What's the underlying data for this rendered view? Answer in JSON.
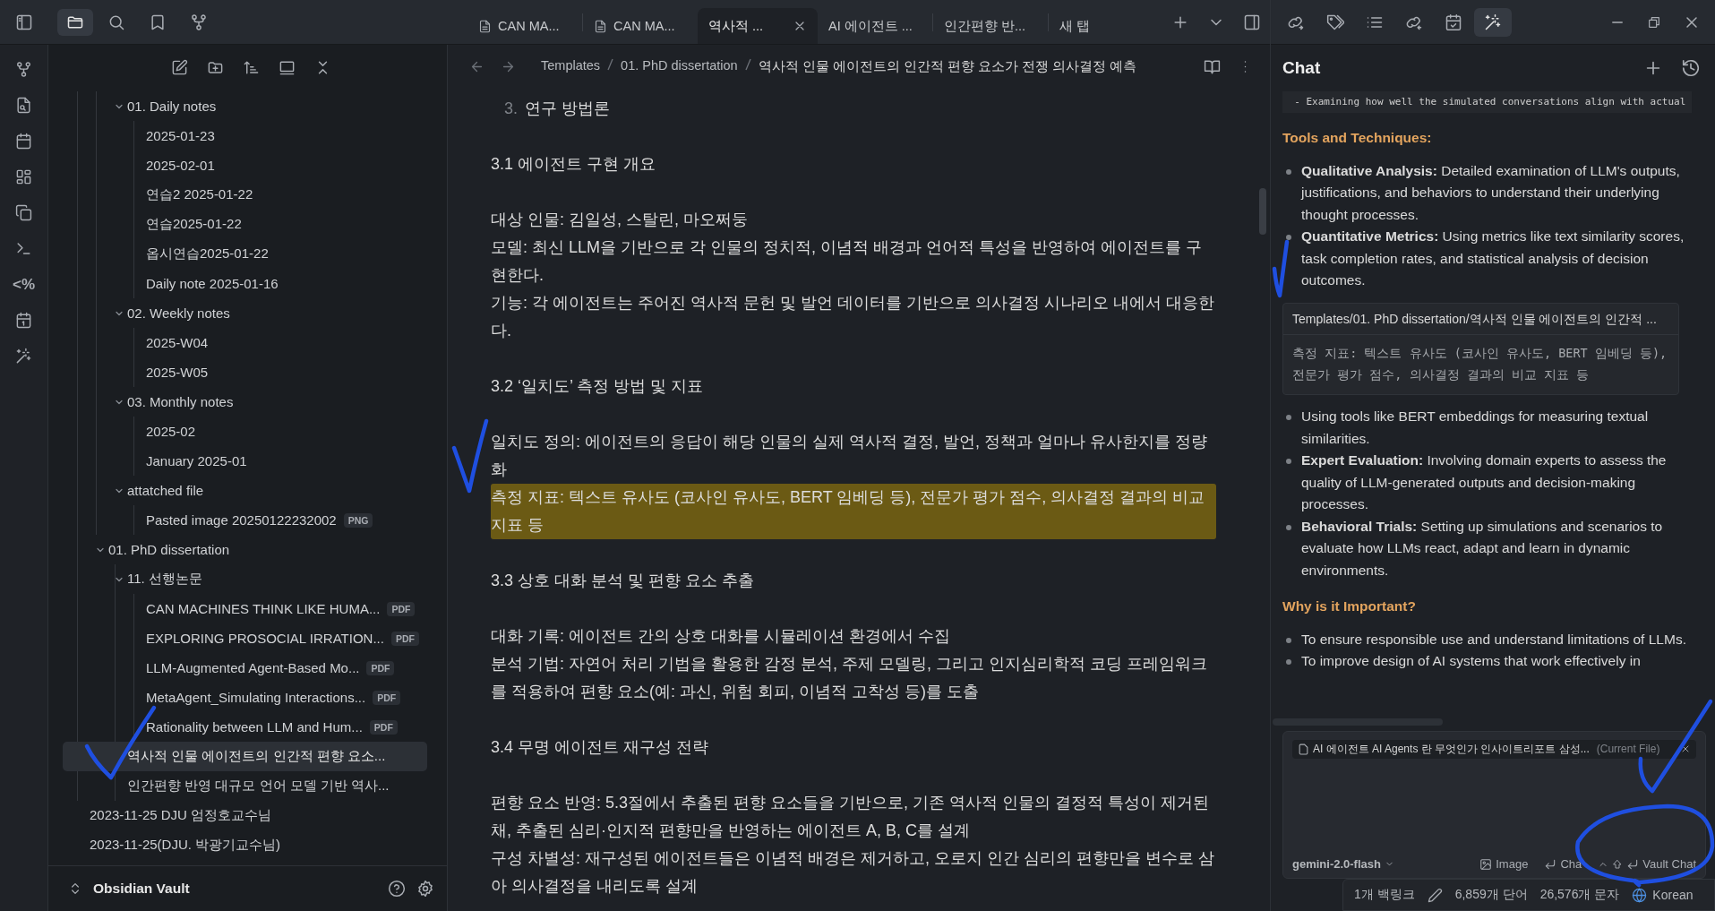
{
  "sidebar_tabs": [
    {
      "kind": "folder",
      "selected": true
    },
    {
      "kind": "search",
      "selected": false
    },
    {
      "kind": "bookmark",
      "selected": false
    },
    {
      "kind": "graph",
      "selected": false
    }
  ],
  "ribbon": [
    {
      "kind": "graph"
    },
    {
      "kind": "file-search"
    },
    {
      "kind": "calendar"
    },
    {
      "kind": "grid"
    },
    {
      "kind": "copy"
    },
    {
      "kind": "terminal"
    },
    {
      "kind": "glyph",
      "text": "<%"
    },
    {
      "kind": "calendar-day"
    },
    {
      "kind": "wand"
    }
  ],
  "file_tree": [
    {
      "children": [
        {
          "children": [
            {
              "label": "01. Daily notes",
              "expanded": true,
              "children": [
                {
                  "label": "2025-01-23",
                  "selected": false
                },
                {
                  "label": "2025-02-01",
                  "selected": false
                },
                {
                  "label": "연습2 2025-01-22",
                  "selected": false
                },
                {
                  "label": "연습2025-01-22",
                  "selected": false
                },
                {
                  "label": "옵시연습2025-01-22",
                  "selected": false
                },
                {
                  "label": "Daily note 2025-01-16",
                  "selected": false
                }
              ]
            },
            {
              "label": "02. Weekly notes",
              "expanded": true,
              "children": [
                {
                  "label": "2025-W04",
                  "selected": false
                },
                {
                  "label": "2025-W05",
                  "selected": false
                }
              ]
            },
            {
              "label": "03. Monthly notes",
              "expanded": true,
              "children": [
                {
                  "label": "2025-02",
                  "selected": false
                },
                {
                  "label": "January 2025-01",
                  "selected": false
                }
              ]
            },
            {
              "label": "attatched file",
              "expanded": true,
              "children": [
                {
                  "label": "Pasted image 20250122232002",
                  "badge": "PNG",
                  "selected": false
                }
              ]
            }
          ]
        },
        {
          "label": "01. PhD dissertation",
          "expanded": true,
          "children": [
            {
              "label": "11. 선행논문",
              "expanded": true,
              "children": [
                {
                  "label": "CAN MACHINES THINK LIKE HUMA...",
                  "badge": "PDF",
                  "selected": false
                },
                {
                  "label": "EXPLORING PROSOCIAL IRRATION...",
                  "badge": "PDF",
                  "selected": false
                },
                {
                  "label": "LLM-Augmented Agent-Based Mo...",
                  "badge": "PDF",
                  "selected": false
                },
                {
                  "label": "MetaAgent_Simulating Interactions...",
                  "badge": "PDF",
                  "selected": false
                },
                {
                  "label": "Rationality between LLM and Hum...",
                  "badge": "PDF",
                  "selected": false
                }
              ]
            },
            {
              "label": "역사적 인물 에이전트의 인간적 편향 요소...",
              "selected": true
            },
            {
              "label": "인간편향 반영 대규모 언어 모델 기반 역사...",
              "selected": false
            }
          ]
        }
      ]
    },
    {
      "label": "2023-11-25 DJU 엄정호교수님",
      "selected": false
    },
    {
      "label": "2023-11-25(DJU. 박광기교수님)",
      "selected": false
    }
  ],
  "vault": {
    "name": "Obsidian Vault"
  },
  "tabs": [
    {
      "label": "CAN MA...",
      "has_icon": true,
      "selected": false
    },
    {
      "label": "CAN MA...",
      "has_icon": true,
      "selected": false
    },
    {
      "label": "역사적 ...",
      "has_icon": false,
      "selected": true
    },
    {
      "label": "AI 에이전트 ...",
      "has_icon": false,
      "selected": false
    },
    {
      "label": "인간편향 반...",
      "has_icon": false,
      "selected": false
    },
    {
      "label": "새 탭",
      "has_icon": false,
      "selected": false
    }
  ],
  "breadcrumb": [
    "Templates",
    "01. PhD dissertation",
    "역사적 인물 에이전트의 인간적 편향 요소가 전쟁 의사결정 예측"
  ],
  "document": {
    "list_marker": "3.",
    "list_item": "연구 방법론",
    "blocks": [
      {
        "kind": "heading",
        "text": "3.1 에이전트 구현 개요"
      },
      {
        "kind": "paragraph",
        "lines": [
          {
            "text": "대상 인물: 김일성, 스탈린, 마오쩌둥",
            "highlighted": false
          },
          {
            "text": "모델: 최신 LLM을 기반으로 각 인물의 정치적, 이념적 배경과 언어적 특성을 반영하여 에이전트를 구현한다.",
            "highlighted": false
          },
          {
            "text": "기능: 각 에이전트는 주어진 역사적 문헌 및 발언 데이터를 기반으로 의사결정 시나리오 내에서 대응한다.",
            "highlighted": false
          }
        ]
      },
      {
        "kind": "heading",
        "text": "3.2 ‘일치도’ 측정 방법 및 지표"
      },
      {
        "kind": "paragraph",
        "lines": [
          {
            "text": "일치도 정의: 에이전트의 응답이 해당 인물의 실제 역사적 결정, 발언, 정책과 얼마나 유사한지를 정량화",
            "highlighted": false
          },
          {
            "text": "측정 지표: 텍스트 유사도 (코사인 유사도, BERT 임베딩 등), 전문가 평가 점수, 의사결정 결과의 비교 지표 등",
            "highlighted": true
          }
        ]
      },
      {
        "kind": "heading",
        "text": "3.3 상호 대화 분석 및 편향 요소 추출"
      },
      {
        "kind": "paragraph",
        "lines": [
          {
            "text": "대화 기록: 에이전트 간의 상호 대화를 시뮬레이션 환경에서 수집",
            "highlighted": false
          },
          {
            "text": "분석 기법: 자연어 처리 기법을 활용한 감정 분석, 주제 모델링, 그리고 인지심리학적 코딩 프레임워크를 적용하여 편향 요소(예: 과신, 위험 회피, 이념적 고착성 등)를 도출",
            "highlighted": false
          }
        ]
      },
      {
        "kind": "heading",
        "text": "3.4 무명 에이전트 재구성 전략"
      },
      {
        "kind": "paragraph",
        "lines": [
          {
            "text": "편향 요소 반영: 5.3절에서 추출된 편향 요소들을 기반으로, 기존 역사적 인물의 결정적 특성이 제거된 채, 추출된 심리·인지적 편향만을 반영하는 에이전트 A, B, C를 설계",
            "highlighted": false
          },
          {
            "text": "구성 차별성: 재구성된 에이전트들은 이념적 배경은 제거하고, 오로지 인간 심리의 편향만을 변수로 삼아 의사결정을 내리도록 설계",
            "highlighted": false
          }
        ]
      }
    ]
  },
  "chat": {
    "title": "Chat",
    "content": [
      {
        "kind": "code",
        "text": "  - Examining how well the simulated conversations align with actual"
      },
      {
        "kind": "heading",
        "text": "Tools and Techniques:"
      },
      {
        "kind": "bullets",
        "items": [
          "**Qualitative Analysis:** Detailed examination of LLM's outputs, justifications, and behaviors to understand their underlying thought processes.",
          "**Quantitative Metrics:** Using metrics like text similarity scores, task completion rates, and statistical analysis of decision outcomes."
        ]
      },
      {
        "kind": "quote",
        "source": "Templates/01. PhD dissertation/역사적 인물 에이전트의 인간적 ...",
        "text": "측정 지표: 텍스트 유사도 (코사인 유사도, BERT 임베딩 등), 전문가 평가 점수, 의사결정 결과의 비교 지표 등"
      },
      {
        "kind": "bullets",
        "items": [
          "Using tools like BERT embeddings for measuring textual similarities.",
          "**Expert Evaluation:** Involving domain experts to assess the quality of LLM-generated outputs and decision-making processes.",
          "**Behavioral Trials:** Setting up simulations and scenarios to evaluate how LLMs react, adapt and learn in dynamic environments."
        ]
      },
      {
        "kind": "heading",
        "text": "Why is it Important?"
      },
      {
        "kind": "bullets",
        "items": [
          "To ensure responsible use and understand limitations of LLMs.",
          "To improve design of AI systems that work effectively in"
        ]
      }
    ]
  },
  "composer": {
    "context_file": "AI 에이전트 AI Agents 란 무엇인가 인사이트리포트 삼성...",
    "context_note": "(Current File)",
    "model": "gemini-2.0-flash",
    "actions": [
      {
        "kind": "image",
        "label": "Image"
      },
      {
        "kind": "enter",
        "label": "Cha"
      },
      {
        "kind": "vault",
        "label": "Vault Chat"
      }
    ]
  },
  "status_bar": {
    "backlinks": "1개 백링크",
    "words": "6,859개 단어",
    "chars": "26,576개 문자",
    "language": "Korean"
  }
}
